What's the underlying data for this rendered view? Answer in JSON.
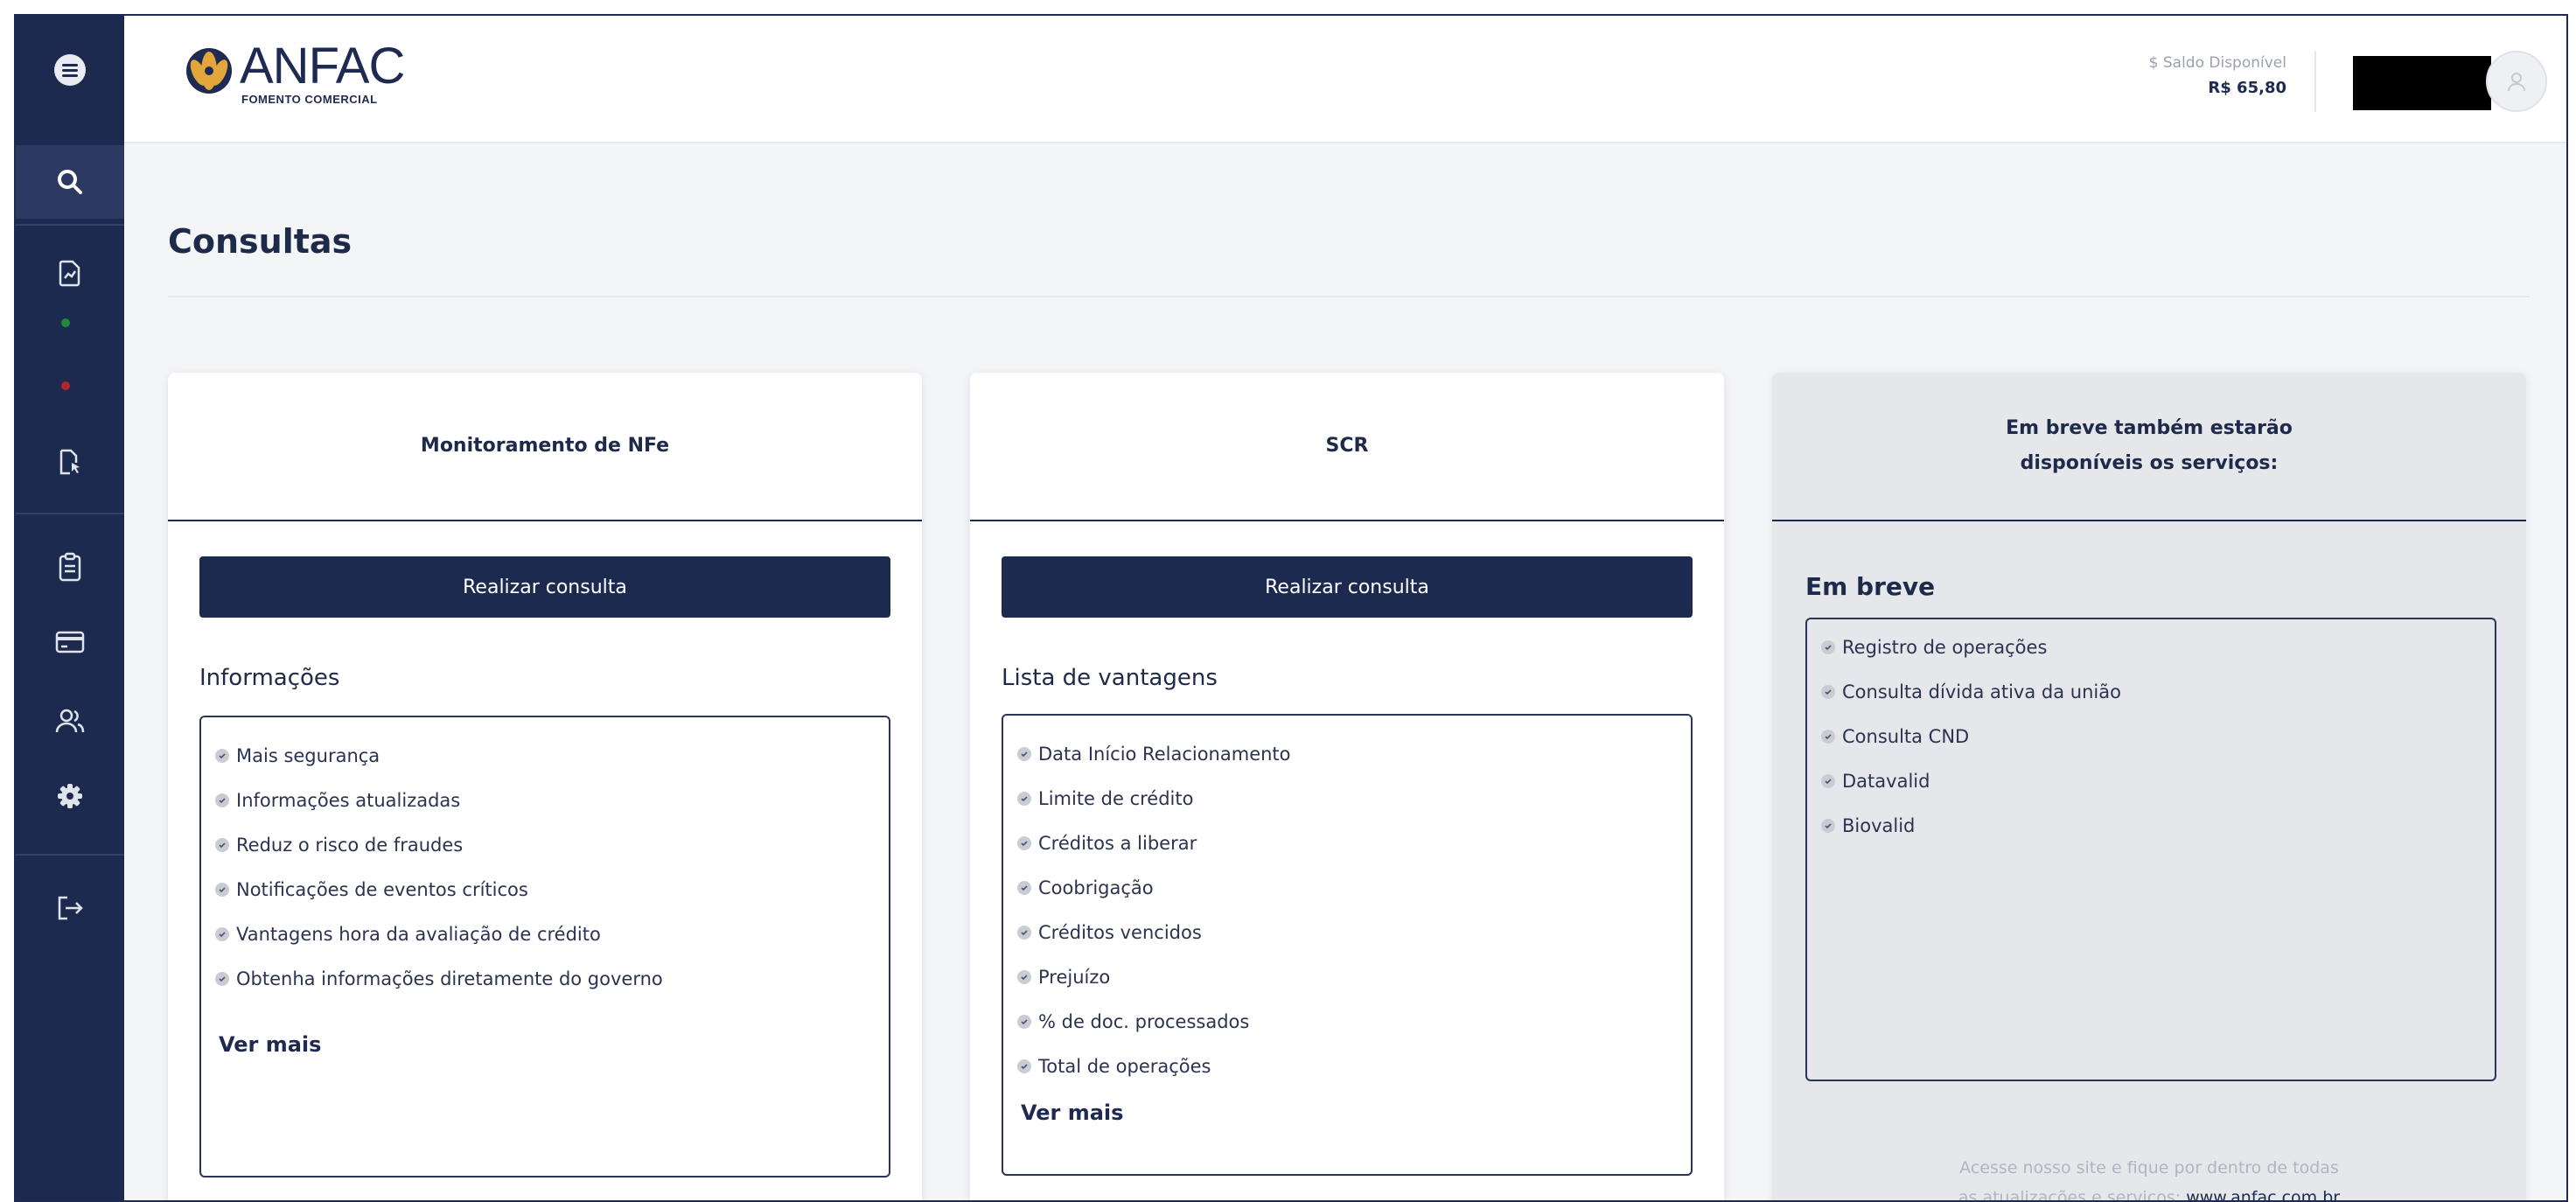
{
  "sidebar": {
    "icons": [
      "menu-icon",
      "search-icon",
      "document-chart-icon",
      "status-dot-green",
      "status-dot-red",
      "document-cursor-icon",
      "clipboard-icon",
      "credit-card-icon",
      "users-icon",
      "gear-icon",
      "logout-icon"
    ]
  },
  "header": {
    "logo_name": "ANFAC",
    "logo_sub": "FOMENTO COMERCIAL",
    "balance_label": "$ Saldo Disponível",
    "balance_value": "R$ 65,80"
  },
  "page": {
    "title": "Consultas"
  },
  "cards": {
    "nfe": {
      "title": "Monitoramento de NFe",
      "button": "Realizar consulta",
      "section": "Informações",
      "items": [
        "Mais segurança",
        "Informações atualizadas",
        "Reduz o risco de fraudes",
        "Notificações de eventos críticos",
        "Vantagens hora da avaliação de crédito",
        "Obtenha informações diretamente do governo"
      ],
      "more": "Ver mais"
    },
    "scr": {
      "title": "SCR",
      "button": "Realizar consulta",
      "section": "Lista de vantagens",
      "items": [
        "Data Início Relacionamento",
        "Limite de crédito",
        "Créditos a liberar",
        "Coobrigação",
        "Créditos vencidos",
        "Prejuízo",
        "% de doc. processados",
        "Total de operações"
      ],
      "more": "Ver mais"
    },
    "soon": {
      "title_line1": "Em breve também estarão",
      "title_line2": "disponíveis os serviços:",
      "section": "Em breve",
      "items": [
        "Registro de operações",
        "Consulta dívida ativa da união",
        "Consulta CND",
        "Datavalid",
        "Biovalid"
      ],
      "footer_line1": "Acesse nosso site e fique por dentro de todas",
      "footer_line2": "as atualizações e serviços:",
      "footer_link": "www.anfac.com.br"
    }
  },
  "colors": {
    "navy": "#1d2a4f",
    "card_gray": "#e5e7eb",
    "dot_green": "#1f8a3a",
    "dot_red": "#b3262d"
  }
}
